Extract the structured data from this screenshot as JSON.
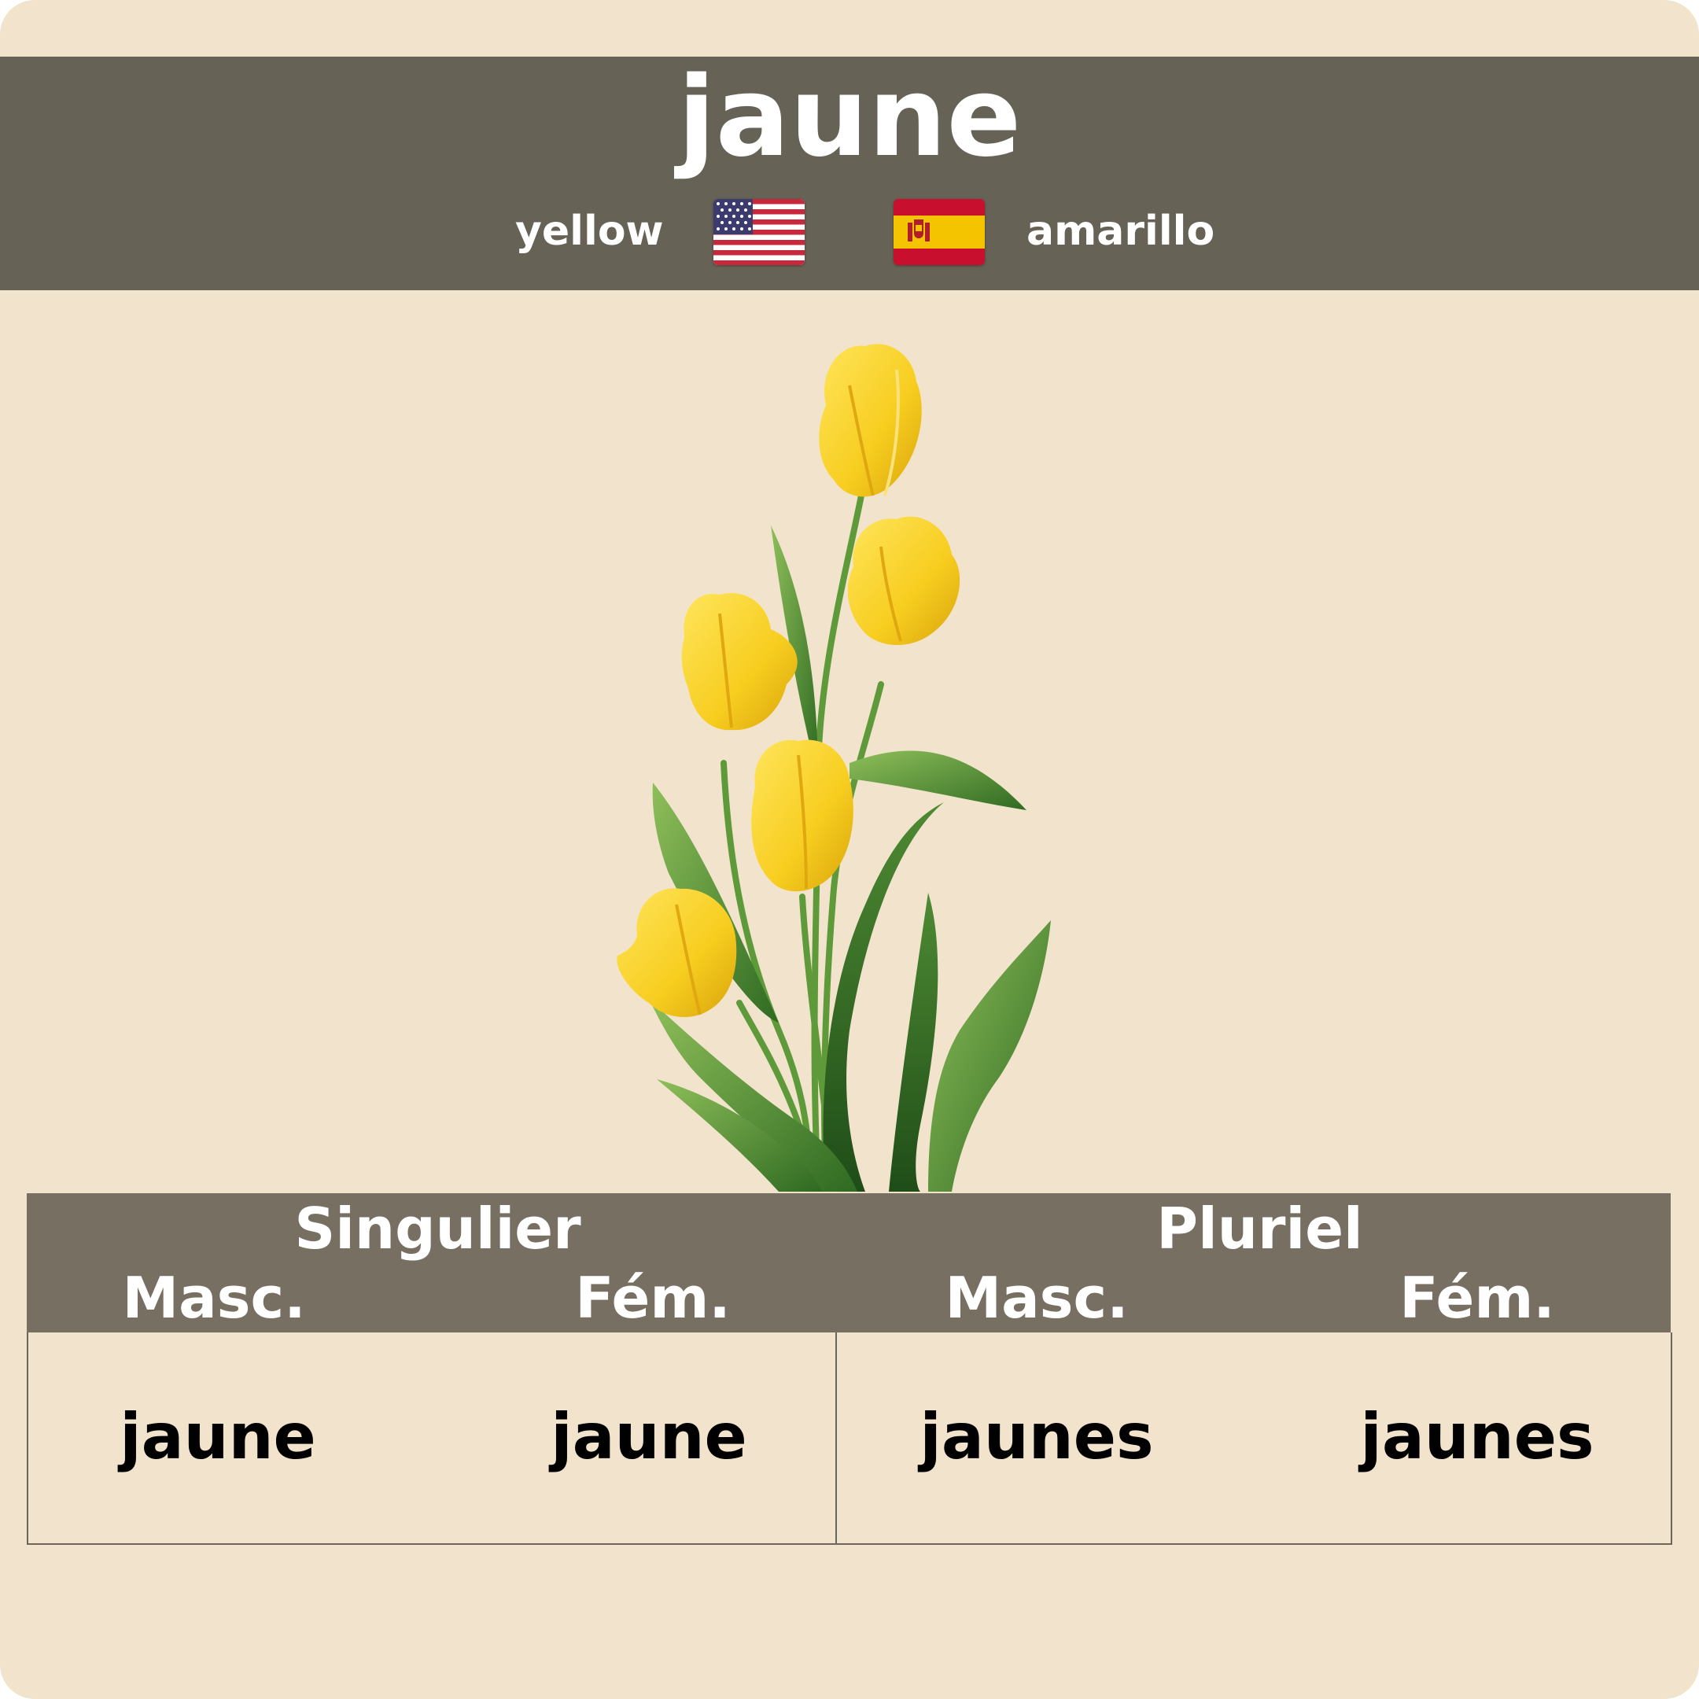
{
  "word": "jaune",
  "translations": {
    "english": "yellow",
    "spanish": "amarillo",
    "english_flag_icon": "us-flag-icon",
    "spanish_flag_icon": "spain-flag-icon"
  },
  "illustration_icon": "yellow-tulips-illustration",
  "table": {
    "singular_label": "Singulier",
    "plural_label": "Pluriel",
    "masc_label": "Masc.",
    "fem_label": "Fém.",
    "singular_masc": "jaune",
    "singular_fem": "jaune",
    "plural_masc": "jaunes",
    "plural_fem": "jaunes"
  },
  "colors": {
    "background": "#f2e4cc",
    "header": "#676256",
    "table_header": "#776f62",
    "text_light": "#ffffff",
    "text_dark": "#000000"
  }
}
